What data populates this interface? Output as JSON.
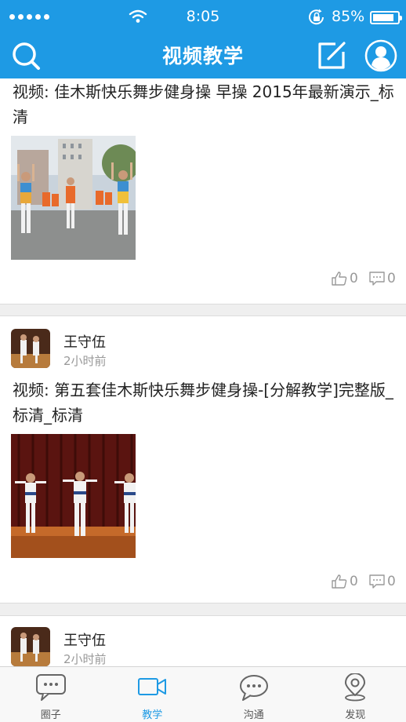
{
  "status_bar": {
    "time": "8:05",
    "battery_percent": "85%",
    "battery_level": 0.85
  },
  "header": {
    "title": "视频教学",
    "icons": [
      "search-icon",
      "edit-icon",
      "user-icon"
    ]
  },
  "colors": {
    "primary": "#1e9ae4",
    "text": "#222222",
    "muted": "#999999"
  },
  "feed": [
    {
      "title": "视频: 佳木斯快乐舞步健身操 早操 2015年最新演示_标清",
      "likes": "0",
      "comments": "0"
    },
    {
      "author": "王守伍",
      "time": "2小时前",
      "title": "视频: 第五套佳木斯快乐舞步健身操-[分解教学]完整版_标清_标清",
      "likes": "0",
      "comments": "0"
    },
    {
      "author": "王守伍",
      "time": "2小时前"
    }
  ],
  "tabbar": {
    "tabs": [
      {
        "label": "圈子",
        "icon": "chat-bubble-icon"
      },
      {
        "label": "教学",
        "icon": "video-camera-icon",
        "active": true
      },
      {
        "label": "沟通",
        "icon": "message-icon"
      },
      {
        "label": "发现",
        "icon": "location-pin-icon"
      }
    ]
  }
}
